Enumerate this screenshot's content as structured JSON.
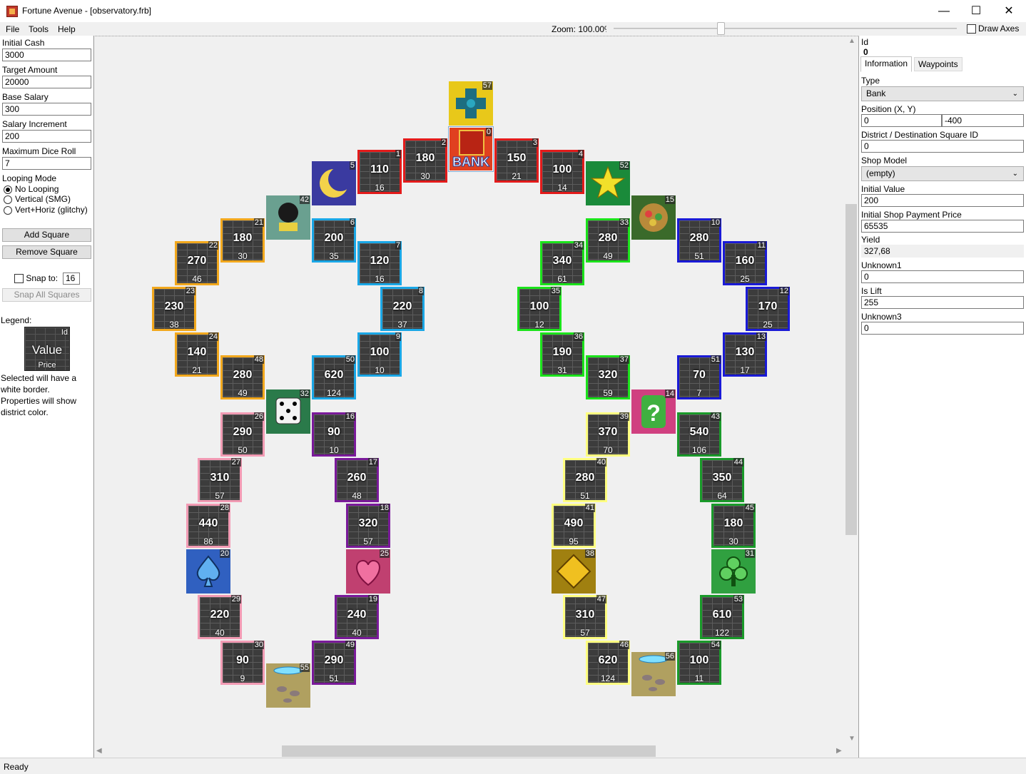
{
  "window": {
    "title": "Fortune Avenue - [observatory.frb]",
    "minimize": "—",
    "maximize": "☐",
    "close": "✕"
  },
  "menu": {
    "file": "File",
    "tools": "Tools",
    "help": "Help"
  },
  "toolbar": {
    "zoom_label": "Zoom: 100.00%",
    "zoom_level": 0.3,
    "draw_axes_label": "Draw Axes",
    "draw_axes_checked": false
  },
  "left": {
    "initial_cash_label": "Initial Cash",
    "initial_cash": "3000",
    "target_amount_label": "Target Amount",
    "target_amount": "20000",
    "base_salary_label": "Base Salary",
    "base_salary": "300",
    "salary_increment_label": "Salary Increment",
    "salary_increment": "200",
    "max_dice_label": "Maximum Dice Roll",
    "max_dice": "7",
    "looping_label": "Looping Mode",
    "looping_options": [
      "No Looping",
      "Vertical (SMG)",
      "Vert+Horiz (glitchy)"
    ],
    "looping_selected": 0,
    "add_square": "Add Square",
    "remove_square": "Remove Square",
    "snap_label": "Snap to:",
    "snap_value": "16",
    "snap_all": "Snap All Squares",
    "legend_title": "Legend:",
    "legend_id": "Id",
    "legend_value": "Value",
    "legend_price": "Price",
    "legend_desc": "Selected will have a white border. Properties will show district color."
  },
  "right": {
    "id_label": "Id",
    "id_value": "0",
    "tab_information": "Information",
    "tab_waypoints": "Waypoints",
    "type_label": "Type",
    "type_value": "Bank",
    "position_label": "Position (X, Y)",
    "pos_x": "0",
    "pos_y": "-400",
    "district_label": "District / Destination Square ID",
    "district_value": "0",
    "shop_model_label": "Shop Model",
    "shop_model_value": "(empty)",
    "initial_value_label": "Initial Value",
    "initial_value": "200",
    "initial_price_label": "Initial Shop Payment Price",
    "initial_price": "65535",
    "yield_label": "Yield",
    "yield_value": "327,68",
    "unknown1_label": "Unknown1",
    "unknown1_value": "0",
    "is_lift_label": "Is Lift",
    "is_lift_value": "255",
    "unknown3_label": "Unknown3",
    "unknown3_value": "0"
  },
  "status": {
    "text": "Ready"
  },
  "colors": {
    "red": "#e31b1b",
    "orange": "#f2a81d",
    "sky": "#1aa7e6",
    "green": "#1be31b",
    "blue": "#1a1ad6",
    "pink": "#f29bb4",
    "purple": "#7a1a9a",
    "yellow": "#ffff80",
    "darkgreen": "#1a9a2a"
  },
  "board": {
    "squares": [
      {
        "id": "57",
        "kind": "warp-cross",
        "col": 0,
        "row": 0
      },
      {
        "id": "0",
        "kind": "bank",
        "label": "BANK"
      },
      {
        "id": "1",
        "value": "110",
        "price": "16",
        "district": "red"
      },
      {
        "id": "2",
        "value": "180",
        "price": "30",
        "district": "red"
      },
      {
        "id": "3",
        "value": "150",
        "price": "21",
        "district": "red"
      },
      {
        "id": "4",
        "value": "100",
        "price": "14",
        "district": "red"
      },
      {
        "id": "5",
        "kind": "moon"
      },
      {
        "id": "52",
        "kind": "star"
      },
      {
        "id": "42",
        "kind": "cannon"
      },
      {
        "id": "15",
        "kind": "vacant-plot"
      },
      {
        "id": "21",
        "value": "180",
        "price": "30",
        "district": "orange"
      },
      {
        "id": "6",
        "value": "200",
        "price": "35",
        "district": "sky"
      },
      {
        "id": "33",
        "value": "280",
        "price": "49",
        "district": "green"
      },
      {
        "id": "10",
        "value": "280",
        "price": "51",
        "district": "blue"
      },
      {
        "id": "22",
        "value": "270",
        "price": "46",
        "district": "orange"
      },
      {
        "id": "7",
        "value": "120",
        "price": "16",
        "district": "sky"
      },
      {
        "id": "34",
        "value": "340",
        "price": "61",
        "district": "green"
      },
      {
        "id": "11",
        "value": "160",
        "price": "25",
        "district": "blue"
      },
      {
        "id": "23",
        "value": "230",
        "price": "38",
        "district": "orange"
      },
      {
        "id": "8",
        "value": "220",
        "price": "37",
        "district": "sky"
      },
      {
        "id": "35",
        "value": "100",
        "price": "12",
        "district": "green"
      },
      {
        "id": "12",
        "value": "170",
        "price": "25",
        "district": "blue"
      },
      {
        "id": "24",
        "value": "140",
        "price": "21",
        "district": "orange"
      },
      {
        "id": "9",
        "value": "100",
        "price": "10",
        "district": "sky"
      },
      {
        "id": "36",
        "value": "190",
        "price": "31",
        "district": "green"
      },
      {
        "id": "13",
        "value": "130",
        "price": "17",
        "district": "blue"
      },
      {
        "id": "48",
        "value": "280",
        "price": "49",
        "district": "orange"
      },
      {
        "id": "50",
        "value": "620",
        "price": "124",
        "district": "sky"
      },
      {
        "id": "37",
        "value": "320",
        "price": "59",
        "district": "green"
      },
      {
        "id": "51",
        "value": "70",
        "price": "7",
        "district": "blue"
      },
      {
        "id": "32",
        "kind": "dice"
      },
      {
        "id": "14",
        "kind": "question"
      },
      {
        "id": "26",
        "value": "290",
        "price": "50",
        "district": "pink"
      },
      {
        "id": "16",
        "value": "90",
        "price": "10",
        "district": "purple"
      },
      {
        "id": "39",
        "value": "370",
        "price": "70",
        "district": "yellow"
      },
      {
        "id": "43",
        "value": "540",
        "price": "106",
        "district": "darkgreen"
      },
      {
        "id": "27",
        "value": "310",
        "price": "57",
        "district": "pink"
      },
      {
        "id": "17",
        "value": "260",
        "price": "48",
        "district": "purple"
      },
      {
        "id": "40",
        "value": "280",
        "price": "51",
        "district": "yellow"
      },
      {
        "id": "44",
        "value": "350",
        "price": "64",
        "district": "darkgreen"
      },
      {
        "id": "28",
        "value": "440",
        "price": "86",
        "district": "pink"
      },
      {
        "id": "18",
        "value": "320",
        "price": "57",
        "district": "purple"
      },
      {
        "id": "41",
        "value": "490",
        "price": "95",
        "district": "yellow"
      },
      {
        "id": "45",
        "value": "180",
        "price": "30",
        "district": "darkgreen"
      },
      {
        "id": "20",
        "kind": "spade"
      },
      {
        "id": "25",
        "kind": "heart"
      },
      {
        "id": "38",
        "kind": "diamond"
      },
      {
        "id": "31",
        "kind": "club"
      },
      {
        "id": "29",
        "value": "220",
        "price": "40",
        "district": "pink"
      },
      {
        "id": "19",
        "value": "240",
        "price": "40",
        "district": "purple"
      },
      {
        "id": "47",
        "value": "310",
        "price": "57",
        "district": "yellow"
      },
      {
        "id": "53",
        "value": "610",
        "price": "122",
        "district": "darkgreen"
      },
      {
        "id": "30",
        "value": "90",
        "price": "9",
        "district": "pink"
      },
      {
        "id": "49",
        "value": "290",
        "price": "51",
        "district": "purple"
      },
      {
        "id": "55",
        "kind": "lift"
      },
      {
        "id": "46",
        "value": "620",
        "price": "124",
        "district": "yellow"
      },
      {
        "id": "56",
        "kind": "lift"
      },
      {
        "id": "54",
        "value": "100",
        "price": "11",
        "district": "darkgreen"
      }
    ]
  }
}
